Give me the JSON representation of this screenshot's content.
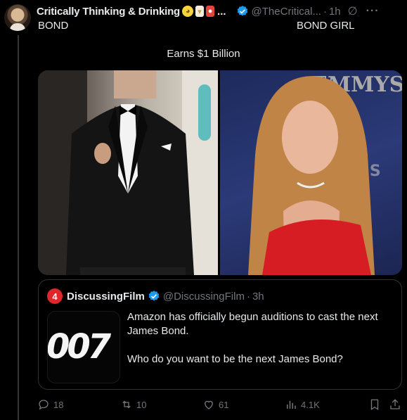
{
  "post": {
    "author": "Critically Thinking & Drinking",
    "handle": "@TheCritical...",
    "time": "1h",
    "separator": "·",
    "name_ellipsis": "...",
    "more": "···",
    "label_left": "BOND",
    "label_right": "BOND GIRL",
    "caption": "Earns $1 Billion"
  },
  "quoted": {
    "author": "DiscussingFilm",
    "handle": "@DiscussingFilm",
    "time": "3h",
    "separator": "·",
    "thumb_text": "007",
    "lines": [
      "Amazon has officially begun auditions to cast the next James Bond.",
      "Who do you want to be the next James Bond?"
    ]
  },
  "actions": {
    "replies": "18",
    "reposts": "10",
    "likes": "61",
    "views": "4.1K"
  },
  "colors": {
    "background": "#000000",
    "text": "#e7e9ea",
    "muted": "#71767b",
    "verified": "#1d9bf0",
    "border": "#2f3336"
  }
}
